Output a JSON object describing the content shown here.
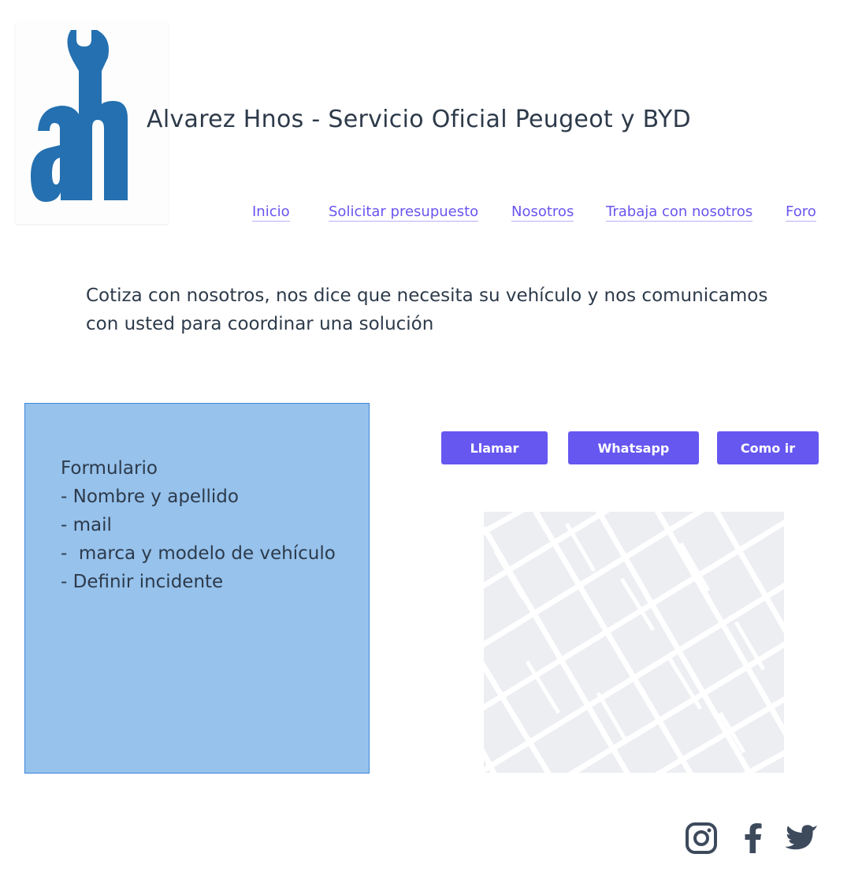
{
  "header": {
    "logo_name": "ah-wrench-logo",
    "title": "Alvarez Hnos - Servicio Oficial Peugeot y BYD"
  },
  "nav": {
    "items": [
      {
        "label": "Inicio"
      },
      {
        "label": "Solicitar presupuesto"
      },
      {
        "label": "Nosotros"
      },
      {
        "label": "Trabaja con nosotros"
      },
      {
        "label": "Foro"
      }
    ]
  },
  "intro": {
    "text": "Cotiza con nosotros, nos dice que necesita su vehículo y nos comunicamos con usted para coordinar una solución"
  },
  "form_box": {
    "lines": [
      "Formulario",
      "- Nombre y apellido",
      "- mail",
      "-  marca y modelo de vehículo",
      "- Definir incidente"
    ]
  },
  "actions": {
    "call_label": "Llamar",
    "whatsapp_label": "Whatsapp",
    "directions_label": "Como ir"
  },
  "map": {
    "icon": "map-placeholder"
  },
  "social": {
    "icons": [
      "instagram-icon",
      "facebook-icon",
      "twitter-icon"
    ]
  },
  "colors": {
    "accent": "#6657f0",
    "link": "#6a55ef",
    "form_bg": "#96c2ec",
    "form_border": "#3d86d8",
    "logo_blue": "#2470b0",
    "text": "#2d3a4a",
    "map_block": "#eceef2",
    "social_icon": "#3d4a5c"
  }
}
